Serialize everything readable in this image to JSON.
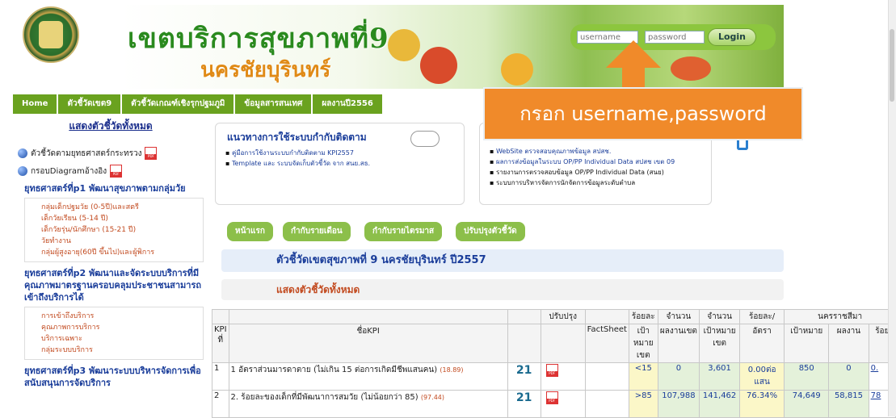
{
  "header": {
    "title_line1": "เขตบริการสุขภาพที่9",
    "title_line2": "นครชัยบุรินทร์",
    "login": {
      "username_placeholder": "username",
      "password_placeholder": "password",
      "button": "Login"
    }
  },
  "callout": {
    "text": "กรอก username,password",
    "color": "#f08a2a"
  },
  "nav": {
    "items": [
      "Home",
      "ตัวชี้วัดเขต9",
      "ตัวชี้วัดเกณฑ์เชิงรุกปฐมภูมิ",
      "ข้อมูลสารสนเทศ",
      "ผลงานปี2556"
    ]
  },
  "sidebar": {
    "title": "แสดงตัวชี้วัดทั้งหมด",
    "items": [
      "ตัวชี้วัดตามยุทธศาสตร์กระทรวง",
      "กรอบDiagramอ้างอิง"
    ],
    "strategies": [
      {
        "head": "ยุทธศาสตร์ที่p1 พัฒนาสุขภาพตามกลุ่มวัย",
        "subs": [
          "กลุ่มเด็กปฐมวัย (0-5ปี)และสตรี",
          "เด็กวัยเรียน (5-14 ปี)",
          "เด็กวัยรุ่น/นักศึกษา (15-21 ปี)",
          "วัยทำงาน",
          "กลุ่มผู้สูงอายุ(60ปี ขึ้นไป)และผู้พิการ"
        ]
      },
      {
        "head": "ยุทธศาสตร์ที่p2 พัฒนาและจัดระบบบริการที่มีคุณภาพมาตรฐานครอบคลุมประชาชนสามารถเข้าถึงบริการได้",
        "subs": [
          "การเข้าถึงบริการ",
          "คุณภาพการบริการ",
          "บริการเฉพาะ",
          "กลุ่มระบบบริการ"
        ]
      },
      {
        "head": "ยุทธศาสตร์ที่p3 พัฒนาระบบบริหารจัดการเพื่อสนับสนุนการจัดบริการ",
        "subs": []
      }
    ]
  },
  "guide": {
    "title": "แนวทางการใช้ระบบกำกับติดตาม",
    "items": [
      "คู่มือการใช้งานระบบกำกับติดตาม KPI2557",
      "Template และ ระบบจัดเก็บตัวชี้วัด จาก สนย.สธ."
    ]
  },
  "links": {
    "items": [
      "WebSite ตรวจสอบคุณภาพข้อมูล สปสช.",
      "ผลการส่งข้อมูลในระบบ OP/PP Individual Data สปสช เขต 09",
      "รายงานการตรวจสอบข้อมูล OP/PP Individual Data (สนย)",
      "ระบบการบริหารจัดการนักจัดการข้อมูลระดับตำบล"
    ]
  },
  "buttons": [
    "หน้าแรก",
    "กำกับรายเดือน",
    "กำกับรายไตรมาส",
    "ปรับปรุงตัวชี้วัด"
  ],
  "kpi_title": "ตัวชี้วัดเขตสุขภาพที่ 9 นครชัยบุรินทร์ ปี2557",
  "show_all": "แสดงตัวชี้วัดทั้งหมด",
  "table": {
    "h": {
      "kpi": "KPI ที่",
      "name": "ชื่อKPI",
      "update": "ปรับปรุง",
      "factsheet": "FactSheet",
      "pct_target": "ร้อยละ",
      "pct_target2": "เป้าหมายเขต",
      "amount_result": "จำนวน",
      "amount_result2": "ผลงานเขต",
      "amount_target": "จำนวน",
      "amount_target2": "เป้าหมายเขต",
      "rate": "ร้อยละ/",
      "rate2": "อัตรา",
      "province": "นครราชสีมา",
      "p_target": "เป้าหมาย",
      "p_result": "ผลงาน",
      "p_pct": "ร้อย"
    },
    "rows": [
      {
        "no": "1",
        "name": "1 อัตราส่วนมารดาตาย (ไม่เกิน 15 ต่อการเกิดมีชีพแสนคน)",
        "red": "(18.89)",
        "icon": "21",
        "target": "<15",
        "result": "0",
        "goal": "3,601",
        "rate": "0.00ต่อแสน",
        "p_target": "850",
        "p_result": "0",
        "p_pct": "0."
      },
      {
        "no": "2",
        "name": "2. ร้อยละของเด็กที่มีพัฒนาการสมวัย (ไม่น้อยกว่า 85)",
        "red": "(97.44)",
        "icon": "21",
        "target": ">85",
        "result": "107,988",
        "goal": "141,462",
        "rate": "76.34%",
        "p_target": "74,649",
        "p_result": "58,815",
        "p_pct": "78"
      }
    ]
  }
}
